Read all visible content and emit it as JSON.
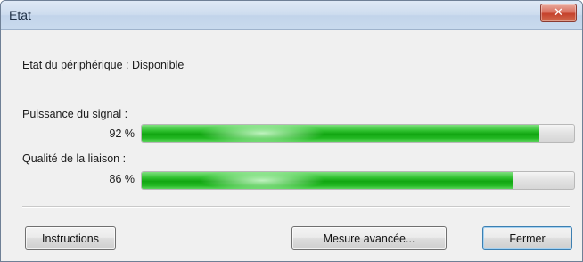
{
  "window": {
    "title": "Etat",
    "close_label": "✕"
  },
  "device_status": {
    "text": "Etat du périphérique : Disponible"
  },
  "signal_strength": {
    "label": "Puissance du signal :",
    "value_text": "92 %",
    "value": 0.92
  },
  "link_quality": {
    "label": "Qualité de la liaison :",
    "value_text": "86 %",
    "value": 0.86
  },
  "buttons": {
    "instructions": "Instructions",
    "advanced_measure": "Mesure avancée...",
    "close": "Fermer"
  },
  "colors": {
    "progress_green": "#12a612",
    "close_button_red": "#c5412b"
  }
}
